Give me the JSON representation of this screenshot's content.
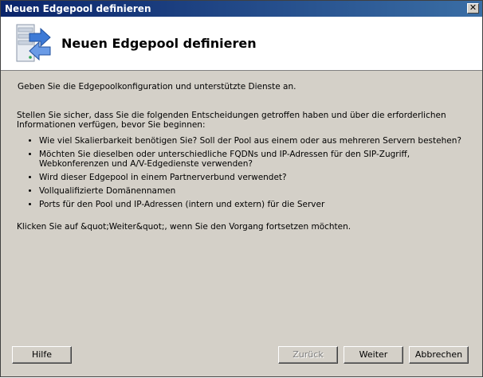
{
  "window": {
    "title": "Neuen Edgepool definieren",
    "close_glyph": "✕"
  },
  "header": {
    "title": "Neuen Edgepool definieren",
    "icon": "server-arrow-icon"
  },
  "content": {
    "intro": "Geben Sie die Edgepoolkonfiguration und unterstützte Dienste an.",
    "paragraph": "Stellen Sie sicher, dass Sie die folgenden Entscheidungen getroffen haben und über die erforderlichen Informationen verfügen, bevor Sie beginnen:",
    "items": [
      "Wie viel Skalierbarkeit benötigen Sie? Soll der Pool aus einem oder aus mehreren Servern bestehen?",
      "Möchten Sie dieselben oder unterschiedliche FQDNs und IP-Adressen für den SIP-Zugriff, Webkonferenzen und A/V-Edgedienste verwenden?",
      "Wird dieser Edgepool in einem Partnerverbund verwendet?",
      "Vollqualifizierte Domänennamen",
      "Ports für den Pool und IP-Adressen (intern und extern) für die Server"
    ],
    "outro": "Klicken Sie auf &quot;Weiter&quot;, wenn Sie den Vorgang fortsetzen möchten."
  },
  "buttons": {
    "help": "Hilfe",
    "back": "Zurück",
    "next": "Weiter",
    "cancel": "Abbrechen"
  }
}
